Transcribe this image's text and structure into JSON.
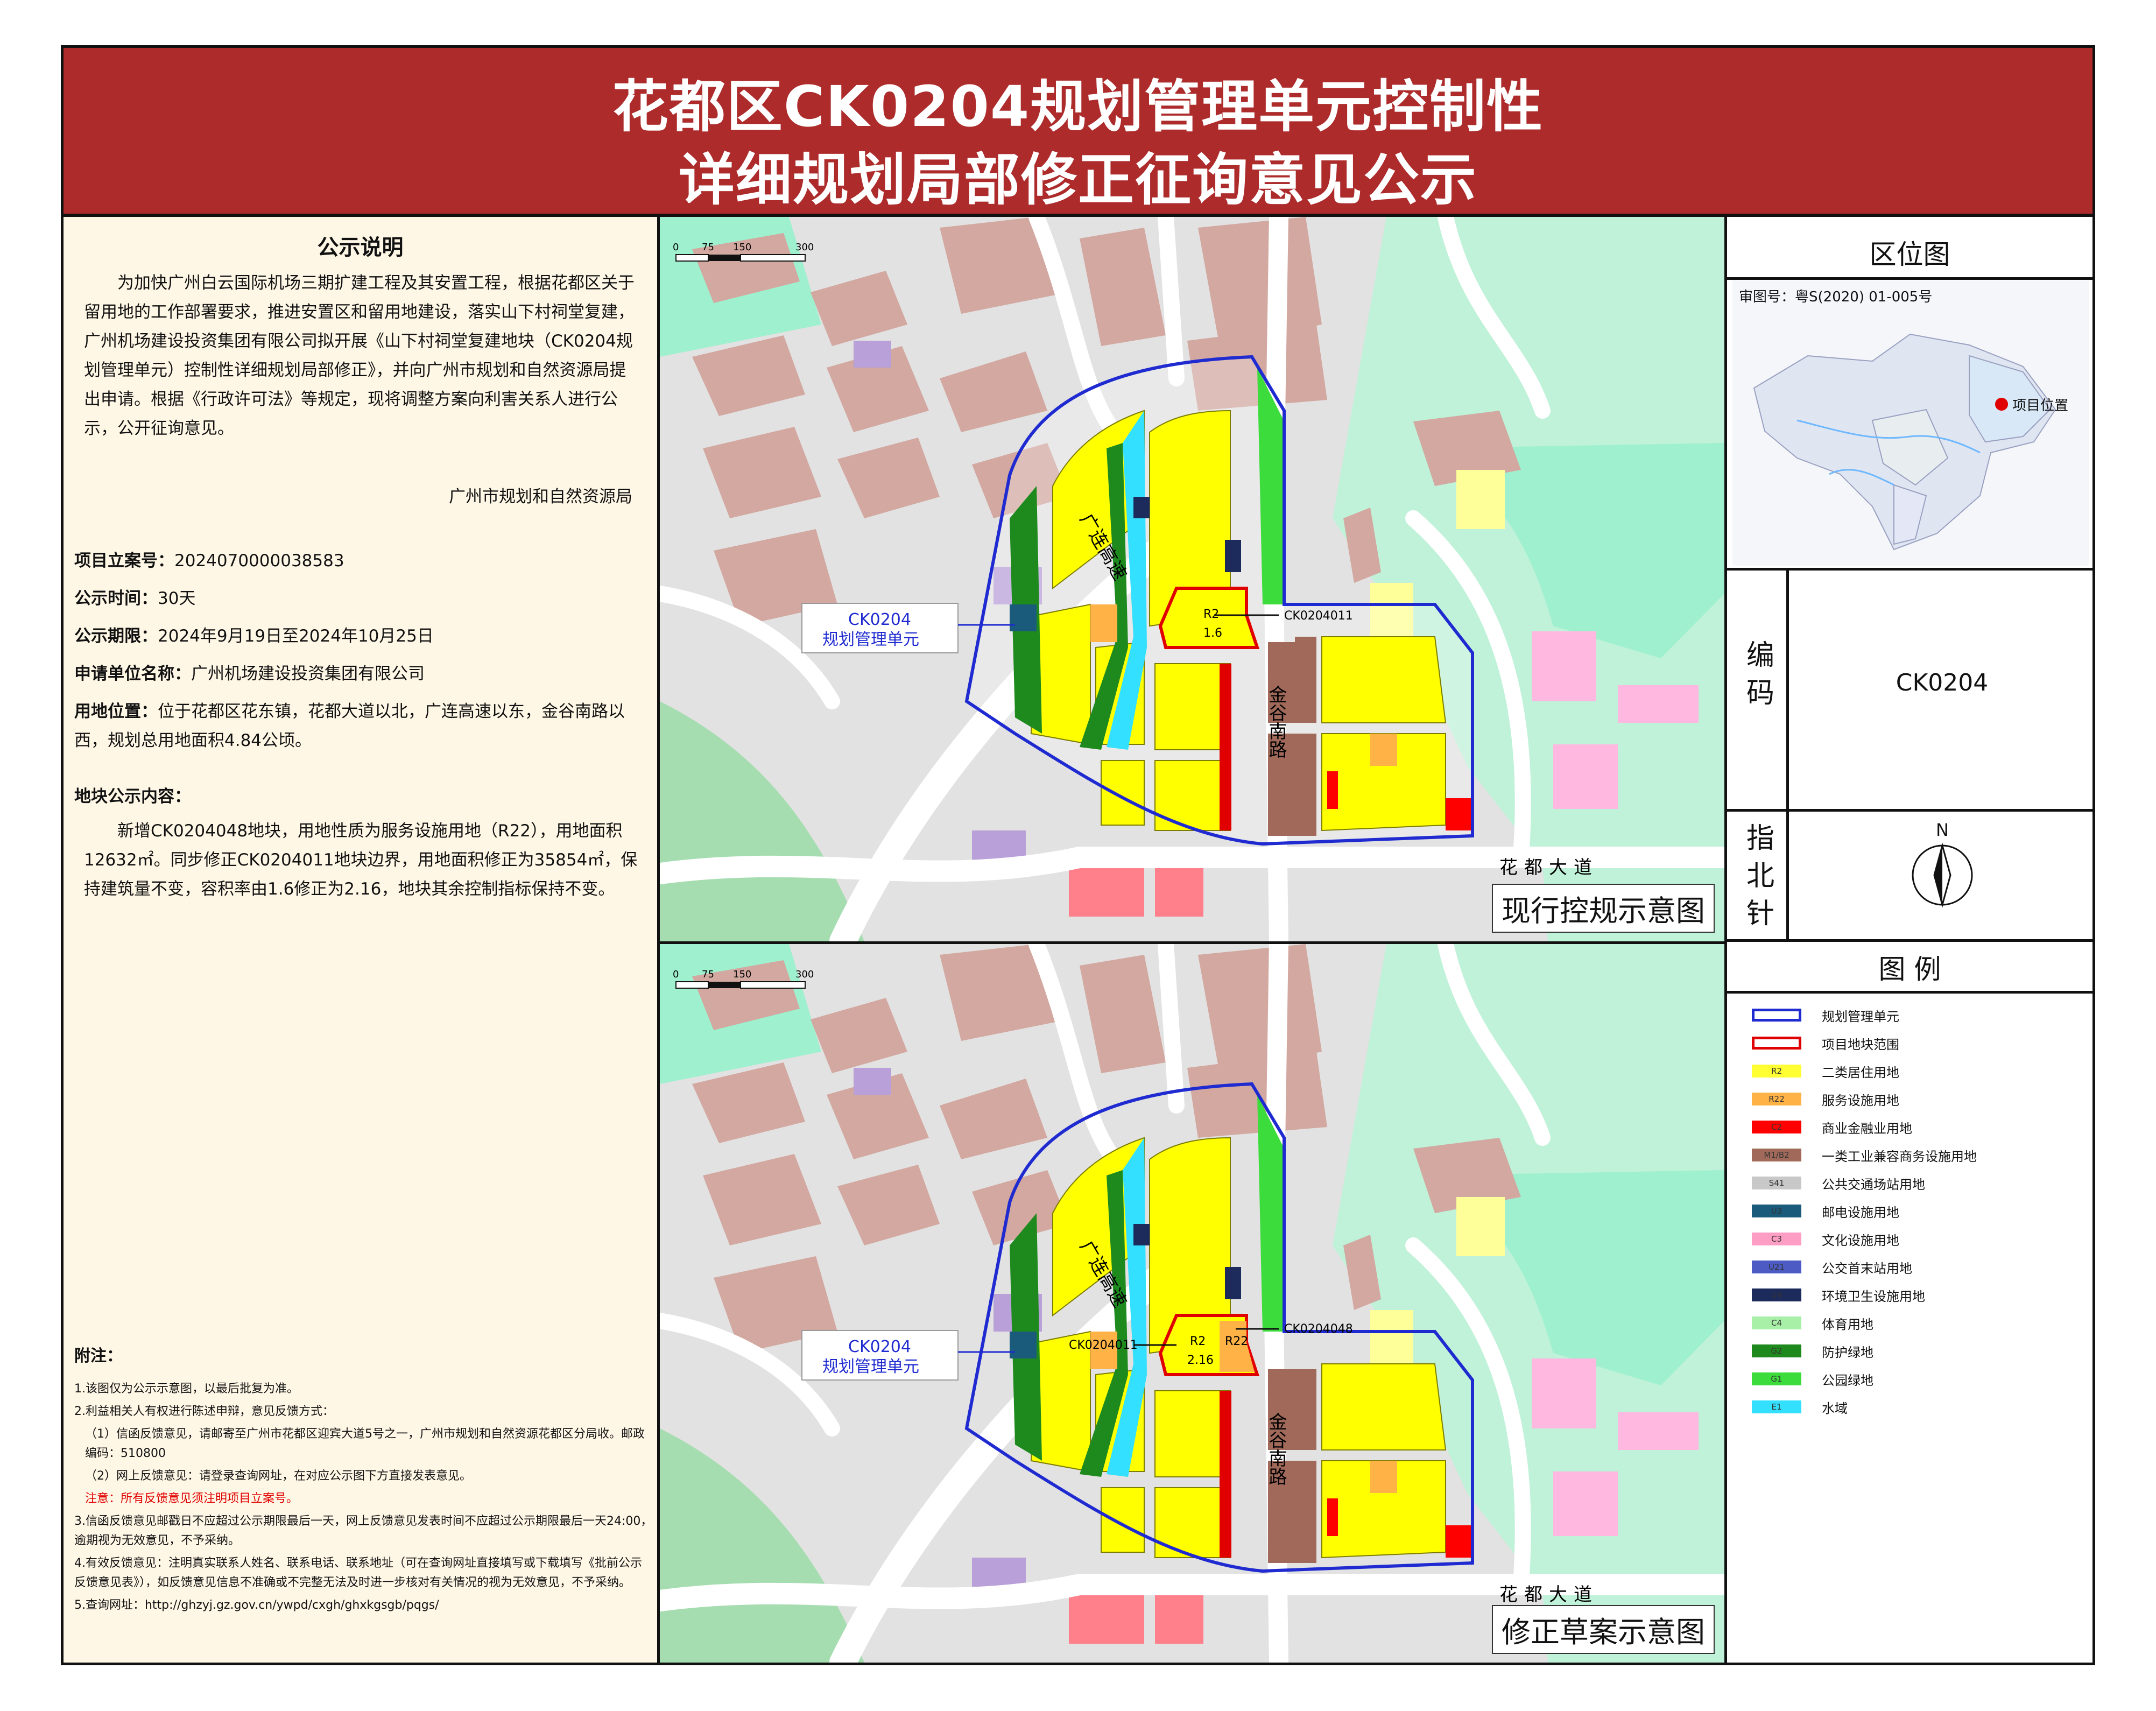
{
  "header": {
    "title_line1": "花都区CK0204规划管理单元控制性",
    "title_line2": "详细规划局部修正征询意见公示"
  },
  "notice": {
    "title": "公示说明",
    "body": "为加快广州白云国际机场三期扩建工程及其安置工程，根据花都区关于留用地的工作部署要求，推进安置区和留用地建设，落实山下村祠堂复建，广州机场建设投资集团有限公司拟开展《山下村祠堂复建地块（CK0204规划管理单元）控制性详细规划局部修正》，并向广州市规划和自然资源局提出申请。根据《行政许可法》等规定，现将调整方案向利害关系人进行公示，公开征询意见。",
    "signature": "广州市规划和自然资源局",
    "project_no_label": "项目立案号：",
    "project_no": "2024070000038583",
    "duration_label": "公示时间：",
    "duration": "30天",
    "period_label": "公示期限：",
    "period": "2024年9月19日至2024年10月25日",
    "applicant_label": "申请单位名称：",
    "applicant": "广州机场建设投资集团有限公司",
    "location_label": "用地位置：",
    "location": "位于花都区花东镇，花都大道以北，广连高速以东，金谷南路以西，规划总用地面积4.84公顷。",
    "content_label": "地块公示内容：",
    "content": "新增CK0204048地块，用地性质为服务设施用地（R22），用地面积12632㎡。同步修正CK0204011地块边界，用地面积修正为35854㎡，保持建筑量不变，容积率由1.6修正为2.16，地块其余控制指标保持不变。"
  },
  "notes": {
    "title": "附注：",
    "n1": "1.该图仅为公示示意图，以最后批复为准。",
    "n2": "2.利益相关人有权进行陈述申辩，意见反馈方式：",
    "n2a": "（1）信函反馈意见，请邮寄至广州市花都区迎宾大道5号之一，广州市规划和自然资源花都区分局收。邮政编码：510800",
    "n2b": "（2）网上反馈意见：请登录查询网址，在对应公示图下方直接发表意见。",
    "n2c": "注意：所有反馈意见须注明项目立案号。",
    "n3": "3.信函反馈意见邮戳日不应超过公示期限最后一天，网上反馈意见发表时间不应超过公示期限最后一天24:00，逾期视为无效意见，不予采纳。",
    "n4": "4.有效反馈意见：注明真实联系人姓名、联系电话、联系地址（可在查询网址直接填写或下载填写《批前公示反馈意见表》），如反馈意见信息不准确或不完整无法及时进一步核对有关情况的视为无效意见，不予采纳。",
    "n5": "5.查询网址：http://ghzyj.gz.gov.cn/ywpd/cxgh/ghxkgsgb/pqgs/"
  },
  "maps": {
    "scale_ticks": [
      "0",
      "75",
      "150",
      "300"
    ],
    "unit_label": "CK0204\n规划管理单元",
    "unit_label_line1": "CK0204",
    "unit_label_line2": "规划管理单元",
    "road_guanglian": "广连高速",
    "road_jingu": "金谷南路",
    "road_huadu": "花都大道",
    "current": {
      "caption": "现行控规示意图",
      "plot_code": "R2",
      "plot_far": "1.6",
      "callout": "CK0204011"
    },
    "revised": {
      "caption": "修正草案示意图",
      "plot_code_a": "R2",
      "plot_code_b": "R22",
      "plot_far": "2.16",
      "callout_left": "CK0204011",
      "callout_right": "CK0204048"
    }
  },
  "right_panel": {
    "location_title": "区位图",
    "approval_no": "审图号：粤S(2020) 01-005号",
    "project_location": "项目位置",
    "code_label": "编码",
    "code_value": "CK0204",
    "north_label": "指北针",
    "north_letter": "N",
    "legend_title": "图 例",
    "legend": [
      {
        "code": "",
        "label": "规划管理单元",
        "color": "#ffffff",
        "border": "#1f2bd0"
      },
      {
        "code": "",
        "label": "项目地块范围",
        "color": "#ffffff",
        "border": "#e00000"
      },
      {
        "code": "R2",
        "label": "二类居住用地",
        "color": "#ffff33"
      },
      {
        "code": "R22",
        "label": "服务设施用地",
        "color": "#ffb347"
      },
      {
        "code": "C2",
        "label": "商业金融业用地",
        "color": "#ff0000"
      },
      {
        "code": "M1/B2",
        "label": "一类工业兼容商务设施用地",
        "color": "#a0695a"
      },
      {
        "code": "S41",
        "label": "公共交通场站用地",
        "color": "#c8c8c8"
      },
      {
        "code": "U3",
        "label": "邮电设施用地",
        "color": "#1a5a7a"
      },
      {
        "code": "C3",
        "label": "文化设施用地",
        "color": "#ff9ec4"
      },
      {
        "code": "U21",
        "label": "公交首末站用地",
        "color": "#4c5cc4"
      },
      {
        "code": "U4",
        "label": "环境卫生设施用地",
        "color": "#1c2a5c"
      },
      {
        "code": "C4",
        "label": "体育用地",
        "color": "#a8f0a8"
      },
      {
        "code": "G2",
        "label": "防护绿地",
        "color": "#1e8a1e"
      },
      {
        "code": "G1",
        "label": "公园绿地",
        "color": "#3cdc3c"
      },
      {
        "code": "E1",
        "label": "水域",
        "color": "#33e0ff"
      }
    ]
  }
}
